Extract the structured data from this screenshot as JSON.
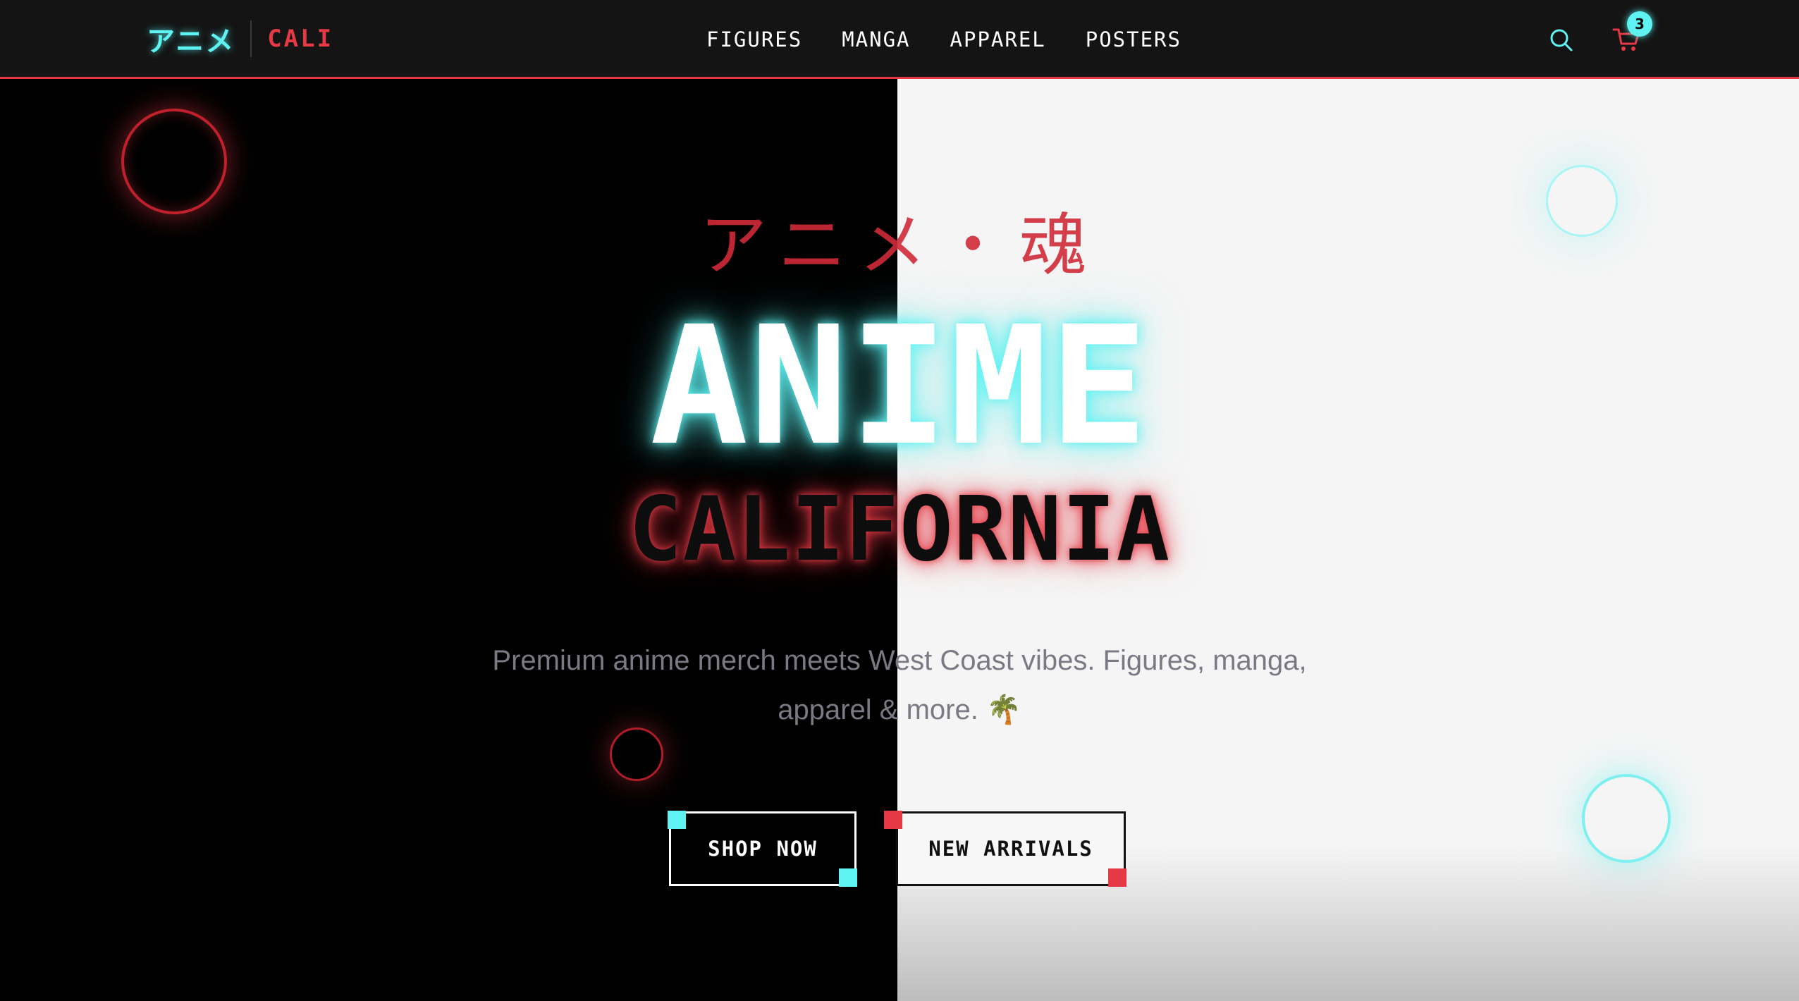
{
  "brand": {
    "logo_jp": "アニメ",
    "logo_en": "CALI"
  },
  "nav": {
    "links": [
      "FIGURES",
      "MANGA",
      "APPAREL",
      "POSTERS"
    ]
  },
  "header_actions": {
    "search_icon": "search-icon",
    "cart_icon": "cart-icon",
    "cart_count": "3"
  },
  "hero": {
    "jp_title": "アニメ・魂",
    "title": "ANIME",
    "subtitle": "CALIFORNIA",
    "tagline_line1": "Premium anime merch meets West Coast vibes. Figures, manga,",
    "tagline_line2": "apparel & more. 🌴"
  },
  "buttons": {
    "primary": "SHOP NOW",
    "secondary": "NEW ARRIVALS"
  },
  "colors": {
    "accent_cyan": "#5ef2f2",
    "accent_red": "#e53945",
    "dark_bg": "#000000",
    "light_bg": "#f5f5f5"
  }
}
